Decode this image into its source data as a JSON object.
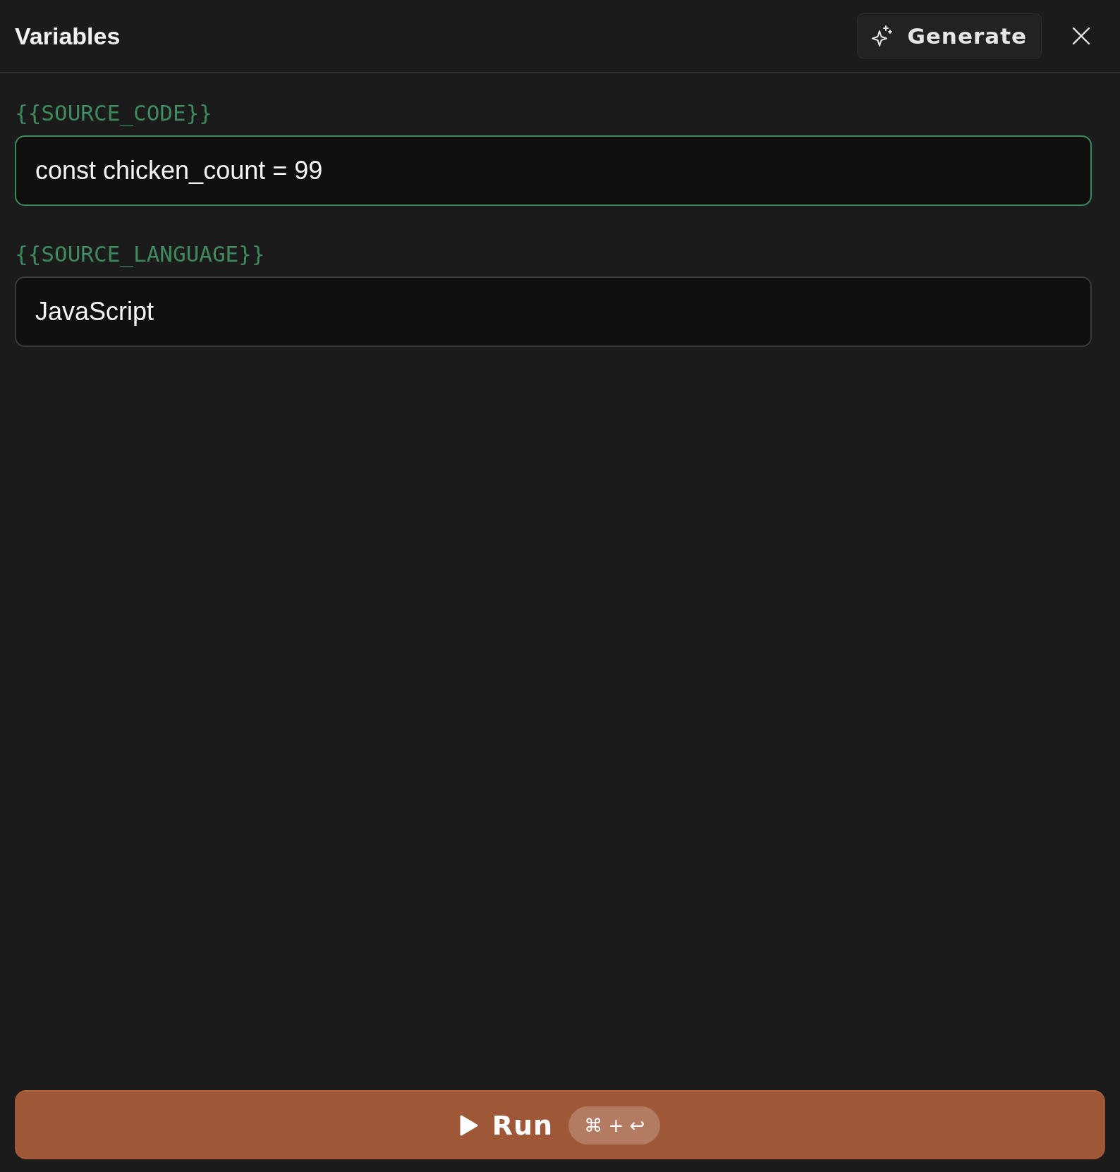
{
  "header": {
    "title": "Variables",
    "generate_button": "Generate"
  },
  "variables": [
    {
      "name": "{{SOURCE_CODE}}",
      "value": "const chicken_count = 99",
      "focused": true
    },
    {
      "name": "{{SOURCE_LANGUAGE}}",
      "value": "JavaScript",
      "focused": false
    }
  ],
  "run_button": {
    "label": "Run",
    "shortcut": "⌘ + ↩"
  }
}
